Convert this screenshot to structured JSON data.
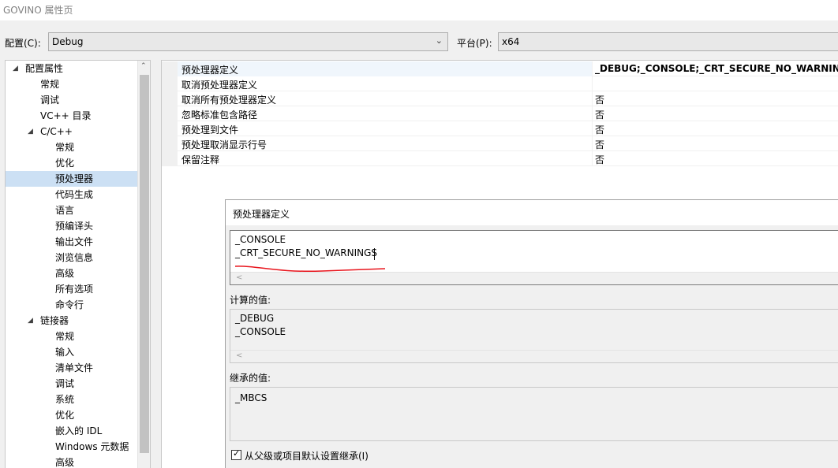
{
  "window": {
    "title": "GOVINO 属性页"
  },
  "config": {
    "config_label": "配置(C):",
    "config_value": "Debug",
    "platform_label": "平台(P):",
    "platform_value": "x64"
  },
  "tree": {
    "items": [
      {
        "label": "配置属性",
        "expanded": true
      },
      {
        "label": "常规"
      },
      {
        "label": "调试"
      },
      {
        "label": "VC++ 目录"
      },
      {
        "label": "C/C++",
        "expanded": true
      },
      {
        "label": "常规"
      },
      {
        "label": "优化"
      },
      {
        "label": "预处理器",
        "selected": true
      },
      {
        "label": "代码生成"
      },
      {
        "label": "语言"
      },
      {
        "label": "预编译头"
      },
      {
        "label": "输出文件"
      },
      {
        "label": "浏览信息"
      },
      {
        "label": "高级"
      },
      {
        "label": "所有选项"
      },
      {
        "label": "命令行"
      },
      {
        "label": "链接器",
        "expanded": true
      },
      {
        "label": "常规"
      },
      {
        "label": "输入"
      },
      {
        "label": "清单文件"
      },
      {
        "label": "调试"
      },
      {
        "label": "系统"
      },
      {
        "label": "优化"
      },
      {
        "label": "嵌入的 IDL"
      },
      {
        "label": "Windows 元数据"
      },
      {
        "label": "高级"
      }
    ]
  },
  "properties": {
    "rows": [
      {
        "name": "预处理器定义",
        "value": "_DEBUG;_CONSOLE;_CRT_SECURE_NO_WARNINGS;%"
      },
      {
        "name": "取消预处理器定义",
        "value": ""
      },
      {
        "name": "取消所有预处理器定义",
        "value": "否"
      },
      {
        "name": "忽略标准包含路径",
        "value": "否"
      },
      {
        "name": "预处理到文件",
        "value": "否"
      },
      {
        "name": "预处理取消显示行号",
        "value": "否"
      },
      {
        "name": "保留注释",
        "value": "否"
      }
    ]
  },
  "dialog": {
    "title": "预处理器定义",
    "edit_lines": [
      "_CONSOLE",
      "_CRT_SECURE_NO_WARNINGS"
    ],
    "evaluated_label": "计算的值:",
    "evaluated_lines": [
      "_DEBUG",
      "_CONSOLE"
    ],
    "inherited_label": "继承的值:",
    "inherited_lines": [
      "_MBCS"
    ],
    "inherit_checkbox_label": "从父级或项目默认设置继承(I)",
    "inherit_checked": true,
    "scroll_left_glyph": "<",
    "annotation_color": "#e8141c"
  },
  "icons": {
    "expanded_glyph": "◢",
    "dropdown_glyph": "⌄",
    "scroll_up_glyph": "⌃",
    "check_glyph": "✓"
  }
}
